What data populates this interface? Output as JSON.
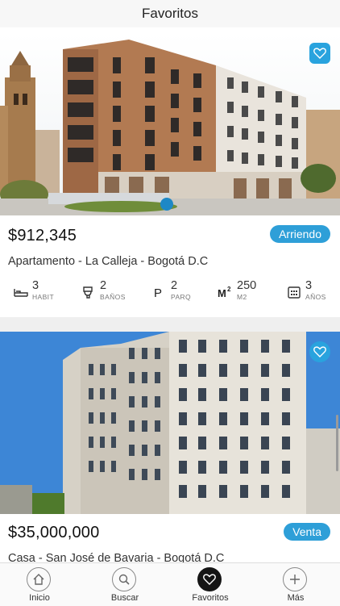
{
  "header": {
    "title": "Favoritos"
  },
  "listings": [
    {
      "price": "$912,345",
      "badge": "Arriendo",
      "title": "Apartamento - La Calleja - Bogotá D.C",
      "specs": [
        {
          "icon": "bed-icon",
          "value": "3",
          "label": "HABIT"
        },
        {
          "icon": "toilet-icon",
          "value": "2",
          "label": "BAÑOS"
        },
        {
          "icon": "parking-icon",
          "value": "2",
          "label": "PARQ"
        },
        {
          "icon": "area-icon",
          "value": "250",
          "label": "M2"
        },
        {
          "icon": "calendar-icon",
          "value": "3",
          "label": "AÑOS"
        }
      ]
    },
    {
      "price": "$35,000,000",
      "badge": "Venta",
      "title": "Casa - San José de Bavaria - Bogotá D.C"
    }
  ],
  "tabbar": {
    "tabs": [
      {
        "icon": "home-icon",
        "label": "Inicio"
      },
      {
        "icon": "search-icon",
        "label": "Buscar"
      },
      {
        "icon": "heart-icon",
        "label": "Favoritos",
        "active": true
      },
      {
        "icon": "plus-icon",
        "label": "Más"
      }
    ]
  },
  "colors": {
    "accent": "#2e9fd8",
    "active_tab": "#151515"
  }
}
